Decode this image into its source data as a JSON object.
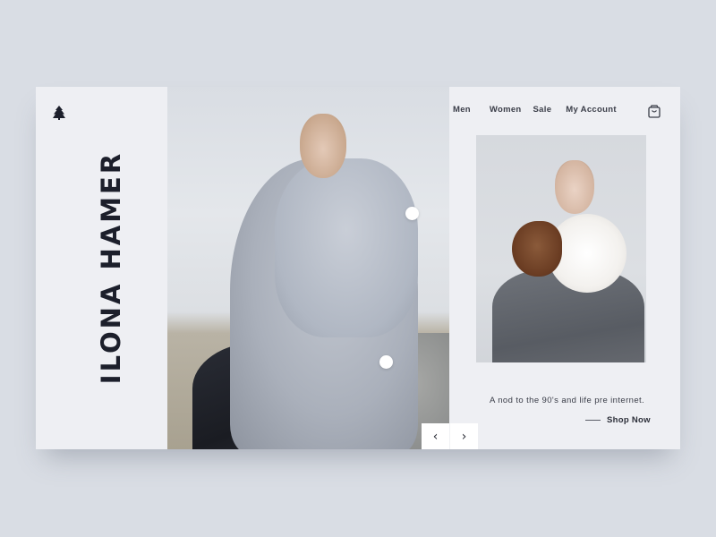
{
  "brand": {
    "name": "ILONA HAMER",
    "logo_icon": "tree-icon"
  },
  "nav": {
    "items": [
      {
        "label": "Men"
      },
      {
        "label": "Women"
      },
      {
        "label": "Sale"
      },
      {
        "label": "My Account"
      }
    ],
    "cart_icon": "shopping-bag-icon"
  },
  "hero": {
    "image_alt": "Model wearing oversized grey wool scarf and coat, seated on rock outdoors",
    "hotspots": 2,
    "controls": {
      "prev_symbol": "‹",
      "next_symbol": "›"
    }
  },
  "feature": {
    "image_alt": "Model wearing brown and white fur stole with grey suit",
    "tagline": "A nod to the 90's and life pre internet.",
    "cta_label": "Shop Now"
  },
  "colors": {
    "background": "#d9dde4",
    "card": "#eeeff3",
    "text_dark": "#1c1f2b",
    "text_nav": "#3a3d48",
    "button_bg": "#ffffff"
  }
}
